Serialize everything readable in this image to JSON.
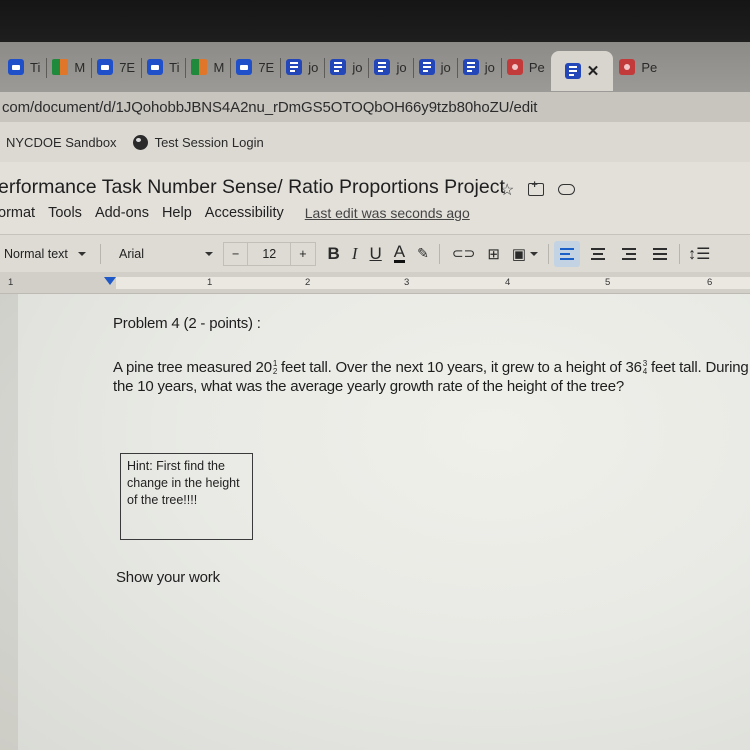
{
  "browser": {
    "tabs": [
      {
        "icon": "zoom",
        "label": "Ti"
      },
      {
        "icon": "meet",
        "label": "M"
      },
      {
        "icon": "zoom",
        "label": "7E"
      },
      {
        "icon": "zoom",
        "label": "Ti"
      },
      {
        "icon": "meet",
        "label": "M"
      },
      {
        "icon": "zoom",
        "label": "7E"
      },
      {
        "icon": "docs",
        "label": "jo"
      },
      {
        "icon": "docs",
        "label": "jo"
      },
      {
        "icon": "docs",
        "label": "jo"
      },
      {
        "icon": "docs",
        "label": "jo"
      },
      {
        "icon": "docs",
        "label": "jo"
      },
      {
        "icon": "slides",
        "label": "Pe"
      },
      {
        "icon": "docs",
        "label": "✕",
        "active": true
      },
      {
        "icon": "slides",
        "label": "Pe"
      }
    ],
    "url": "com/document/d/1JQohobbJBNS4A2nu_rDmGS5OTOQbOH66y9tzb80hoZU/edit",
    "bookmarks": [
      {
        "label": "NYCDOE Sandbox"
      },
      {
        "label": "Test Session Login",
        "icon": "globe-icon"
      }
    ]
  },
  "doc": {
    "title": "erformance Task Number Sense/ Ratio Proportions Project",
    "menu": [
      "ormat",
      "Tools",
      "Add-ons",
      "Help",
      "Accessibility"
    ],
    "last_edit": "Last edit was seconds ago",
    "toolbar": {
      "style": "Normal text",
      "font": "Arial",
      "size_minus": "−",
      "size": "12",
      "size_plus": "+",
      "bold": "B",
      "italic": "I",
      "underline": "U",
      "text_color": "A"
    },
    "ruler_numbers": [
      "1",
      "1",
      "2",
      "3",
      "4",
      "5",
      "6"
    ],
    "content": {
      "problem_title": "Problem 4 (2 - points) :",
      "body_part1": "A pine tree measured 20",
      "frac1_num": "1",
      "frac1_den": "2",
      "body_part2": " feet tall.  Over the next 10 years, it grew to a height of 36",
      "frac2_num": "3",
      "frac2_den": "4",
      "body_part3": " feet tall.  During the 10 years, what was the average yearly growth rate of the height of the tree?",
      "hint": "Hint: First find the change in the height of the tree!!!!",
      "show_work": "Show your work"
    }
  },
  "colors": {
    "docs_blue": "#2346b8",
    "zoom_blue": "#1f4fc9",
    "slides_red": "#c23a3a",
    "align_active": "#1a5ec7"
  }
}
